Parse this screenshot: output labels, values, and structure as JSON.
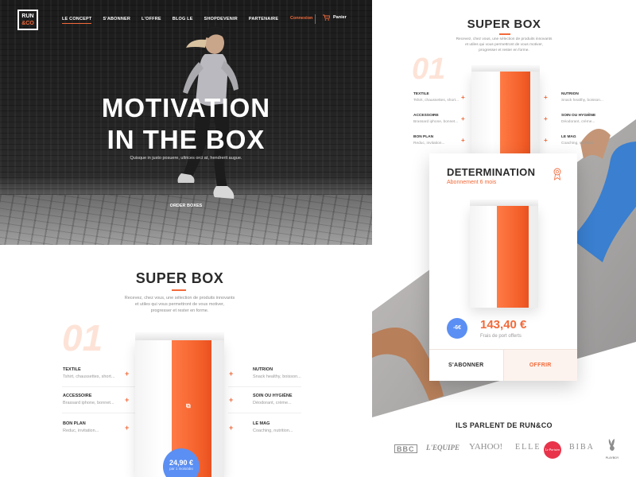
{
  "header": {
    "logo_line1": "RUN",
    "logo_line2": "&CO",
    "nav": [
      "LE CONCEPT",
      "S'ABONNER",
      "L'OFFRE",
      "BLOG LE",
      "SHOPDEVENIR",
      "PARTENAIRE"
    ],
    "login": "Connexion",
    "cart": "Panier"
  },
  "hero": {
    "title_line1": "MOTIVATION",
    "title_line2": "IN THE BOX",
    "subtitle": "Quisque in justo posuere, ultrices orci at, hendrerit augue.",
    "cta": "ORDER BOXES"
  },
  "superbox": {
    "title": "SUPER BOX",
    "description_l1": "Recevez, chez vous, une sélection de produits innovants",
    "description_l2": "et utiles qui vous permettront de vous motiver,",
    "description_l3": "progresser et rester en forme.",
    "number": "01",
    "left_features": [
      {
        "title": "TEXTILE",
        "desc": "Tshirt, chaussettes, short..."
      },
      {
        "title": "ACCESSOIRE",
        "desc": "Brassard iphone, bonnet..."
      },
      {
        "title": "BON PLAN",
        "desc": "Reduc, invitation..."
      }
    ],
    "right_features": [
      {
        "title": "NUTRION",
        "desc": "Snack healthy, boisson..."
      },
      {
        "title": "SOIN OU HYGIÈNE",
        "desc": "Déodorant, crème..."
      },
      {
        "title": "LE MAG",
        "desc": "Coaching, nutrition..."
      }
    ],
    "price": "24,90 €",
    "price_note": "par 1 mois/abo"
  },
  "card": {
    "title": "DETERMINATION",
    "subtitle": "Abonnement 6 mois",
    "discount": "-6€",
    "price": "143,40 €",
    "shipping": "Frais de port offerts",
    "subscribe": "S'ABONNER",
    "offer": "OFFRIR"
  },
  "press": {
    "title": "ILS PARLENT DE RUN&CO",
    "logos": [
      "BBC",
      "L'EQUIPE",
      "YAHOO!",
      "ELLE",
      "Le Parisien",
      "BIBA",
      "PLAYBOY"
    ]
  },
  "colors": {
    "accent": "#f26a3a",
    "blue": "#5b8ff3",
    "dark": "#2b2b2b"
  }
}
